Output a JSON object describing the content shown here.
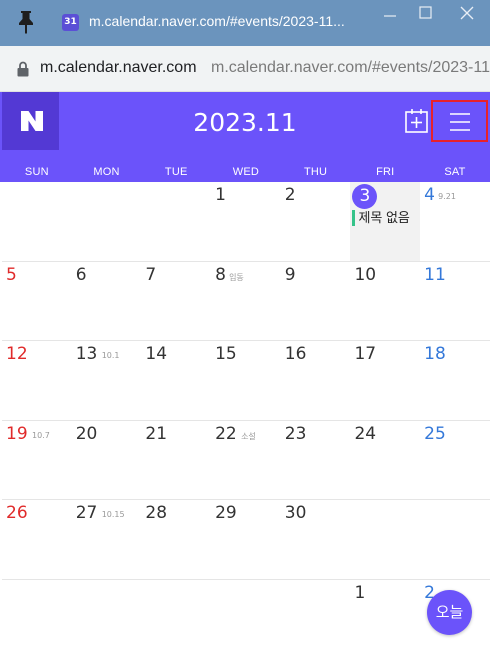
{
  "browser": {
    "tab_title": "m.calendar.naver.com/#events/2023-11...",
    "favicon_text": "31",
    "url_host": "m.calendar.naver.com",
    "url_full": "m.calendar.naver.com/#events/2023-11"
  },
  "calendar": {
    "logo": "N",
    "month_title": "2023.11",
    "weekdays": [
      "SUN",
      "MON",
      "TUE",
      "WED",
      "THU",
      "FRI",
      "SAT"
    ],
    "today_label": "오늘",
    "colors": {
      "brand": "#6b53fa",
      "logo_bg": "#5339d4",
      "sunday": "#e02a2a",
      "saturday": "#3478d9",
      "event_bar": "#35c38a",
      "highlight_border": "#e8212a"
    },
    "weeks": [
      [
        {
          "day": ""
        },
        {
          "day": ""
        },
        {
          "day": ""
        },
        {
          "day": "1"
        },
        {
          "day": "2"
        },
        {
          "day": "3",
          "today": true,
          "event": "제목 없음"
        },
        {
          "day": "4",
          "lunar": "9.21"
        }
      ],
      [
        {
          "day": "5"
        },
        {
          "day": "6"
        },
        {
          "day": "7"
        },
        {
          "day": "8",
          "lunar": "입동"
        },
        {
          "day": "9"
        },
        {
          "day": "10"
        },
        {
          "day": "11"
        }
      ],
      [
        {
          "day": "12"
        },
        {
          "day": "13",
          "lunar": "10.1"
        },
        {
          "day": "14"
        },
        {
          "day": "15"
        },
        {
          "day": "16"
        },
        {
          "day": "17"
        },
        {
          "day": "18"
        }
      ],
      [
        {
          "day": "19",
          "lunar": "10.7"
        },
        {
          "day": "20"
        },
        {
          "day": "21"
        },
        {
          "day": "22",
          "lunar": "소설"
        },
        {
          "day": "23"
        },
        {
          "day": "24"
        },
        {
          "day": "25"
        }
      ],
      [
        {
          "day": "26"
        },
        {
          "day": "27",
          "lunar": "10.15"
        },
        {
          "day": "28"
        },
        {
          "day": "29"
        },
        {
          "day": "30"
        },
        {
          "day": ""
        },
        {
          "day": ""
        }
      ],
      [
        {
          "day": ""
        },
        {
          "day": ""
        },
        {
          "day": ""
        },
        {
          "day": ""
        },
        {
          "day": ""
        },
        {
          "day": "1"
        },
        {
          "day": "2"
        }
      ]
    ]
  }
}
